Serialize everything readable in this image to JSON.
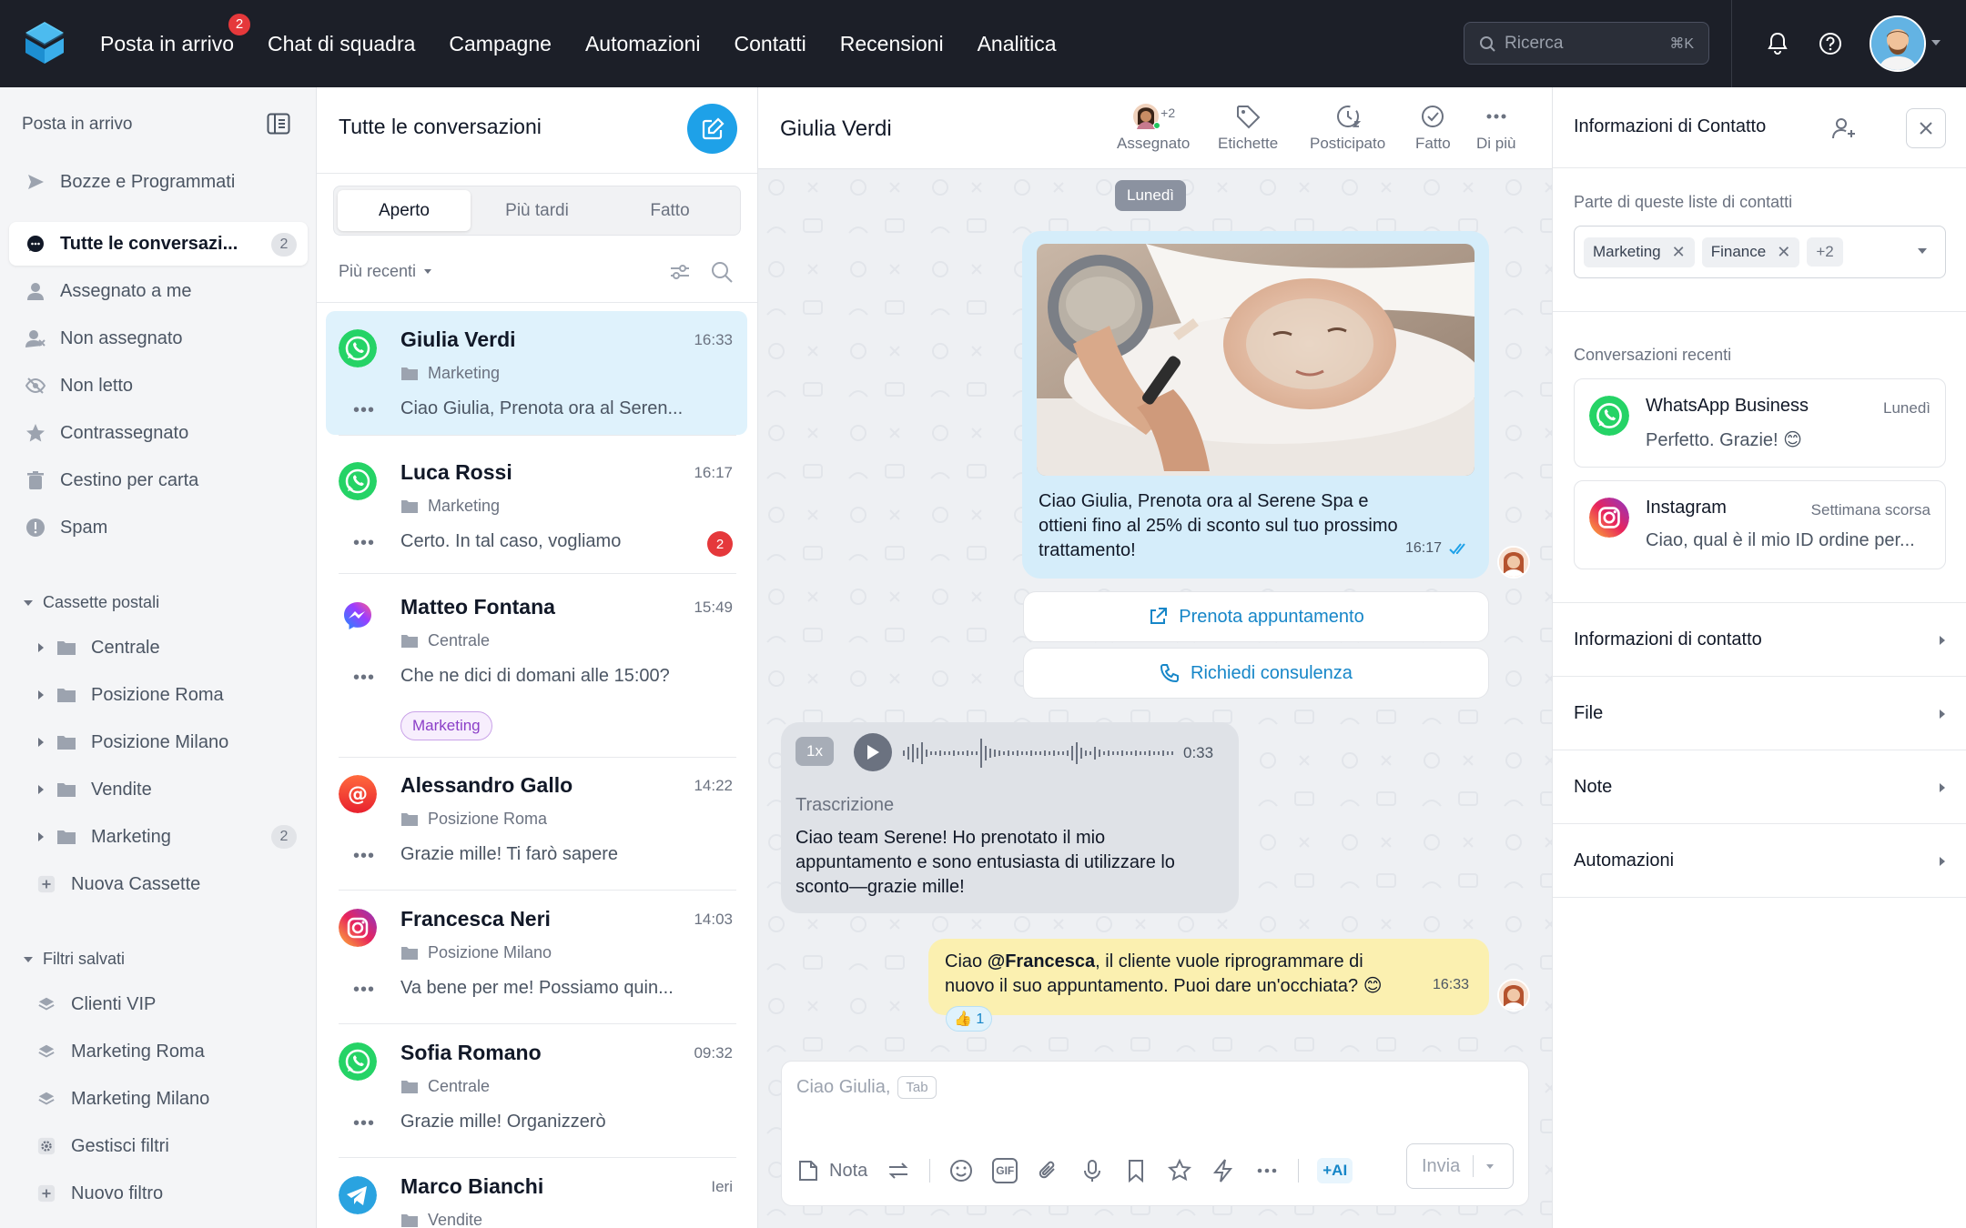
{
  "topnav": {
    "items": [
      "Posta in arrivo",
      "Chat di squadra",
      "Campagne",
      "Automazioni",
      "Contatti",
      "Recensioni",
      "Analitica"
    ],
    "inbox_badge": "2",
    "search_placeholder": "Ricerca",
    "search_shortcut": "⌘K",
    "icons": [
      "bell-icon",
      "help-icon"
    ]
  },
  "sidebar": {
    "title": "Posta in arrivo",
    "items": [
      {
        "label": "Bozze e Programmati",
        "icon": "send-icon"
      },
      {
        "label": "Tutte le conversazi...",
        "icon": "chat-icon",
        "count": "2",
        "active": true
      },
      {
        "label": "Assegnato a me",
        "icon": "user-icon"
      },
      {
        "label": "Non assegnato",
        "icon": "user-x-icon"
      },
      {
        "label": "Non letto",
        "icon": "eye-off-icon"
      },
      {
        "label": "Contrassegnato",
        "icon": "star-icon"
      },
      {
        "label": "Cestino per carta",
        "icon": "trash-icon"
      },
      {
        "label": "Spam",
        "icon": "alert-icon"
      }
    ],
    "mailboxes_title": "Cassette postali",
    "mailboxes": [
      {
        "label": "Centrale"
      },
      {
        "label": "Posizione Roma"
      },
      {
        "label": "Posizione Milano"
      },
      {
        "label": "Vendite"
      },
      {
        "label": "Marketing",
        "count": "2"
      }
    ],
    "new_mailbox": "Nuova Cassette",
    "filters_title": "Filtri salvati",
    "filters": [
      "Clienti VIP",
      "Marketing Roma",
      "Marketing Milano"
    ],
    "manage_filters": "Gestisci filtri",
    "new_filter": "Nuovo filtro"
  },
  "convlist": {
    "title": "Tutte le conversazioni",
    "tabs": [
      "Aperto",
      "Più tardi",
      "Fatto"
    ],
    "sort": "Più recenti",
    "conversations": [
      {
        "name": "Giulia Verdi",
        "time": "16:33",
        "folder": "Marketing",
        "preview": "Ciao Giulia, Prenota ora al Seren...",
        "channel": "whatsapp"
      },
      {
        "name": "Luca Rossi",
        "time": "16:17",
        "folder": "Marketing",
        "preview": "Certo. In tal caso, vogliamo",
        "channel": "whatsapp",
        "unread": "2"
      },
      {
        "name": "Matteo Fontana",
        "time": "15:49",
        "folder": "Centrale",
        "preview": "Che ne dici di domani alle 15:00?",
        "channel": "messenger",
        "tag": "Marketing"
      },
      {
        "name": "Alessandro Gallo",
        "time": "14:22",
        "folder": "Posizione Roma",
        "preview": "Grazie mille! Ti farò sapere",
        "channel": "email"
      },
      {
        "name": "Francesca Neri",
        "time": "14:03",
        "folder": "Posizione Milano",
        "preview": "Va bene per me! Possiamo quin...",
        "channel": "instagram"
      },
      {
        "name": "Sofia Romano",
        "time": "09:32",
        "folder": "Centrale",
        "preview": "Grazie mille! Organizzerò",
        "channel": "whatsapp"
      },
      {
        "name": "Marco Bianchi",
        "time": "Ieri",
        "folder": "Vendite",
        "preview": "",
        "channel": "telegram"
      }
    ]
  },
  "chat": {
    "title": "Giulia Verdi",
    "assignee_extra": "+2",
    "actions": [
      "Assegnato",
      "Etichette",
      "Posticipato",
      "Fatto",
      "Di più"
    ],
    "day": "Lunedì",
    "outgoing_text": "Ciao Giulia, Prenota ora al Serene Spa e ottieni fino al 25% di sconto sul tuo prossimo trattamento!",
    "outgoing_time": "16:17",
    "cta_1": "Prenota appuntamento",
    "cta_2": "Richiedi consulenza",
    "audio_speed": "1x",
    "audio_duration": "0:33",
    "transcript_label": "Trascrizione",
    "transcript_text": "Ciao team Serene! Ho prenotato il mio appuntamento e sono entusiasta di utilizzare lo sconto—grazie mille!",
    "note_prefix": "Ciao ",
    "note_mention": "@Francesca",
    "note_rest": ", il cliente vuole riprogrammare di nuovo il suo appuntamento. Puoi dare un'occhiata? 😊",
    "note_time": "16:33",
    "reaction": "👍 1",
    "composer_placeholder": "Ciao Giulia,",
    "composer_tab": "Tab",
    "nota_label": "Nota",
    "gif_label": "GIF",
    "ai_label": "+AI",
    "send_label": "Invia"
  },
  "contact": {
    "title": "Informazioni di Contatto",
    "lists_label": "Parte di queste liste di contatti",
    "lists": [
      "Marketing",
      "Finance"
    ],
    "lists_more": "+2",
    "recent_label": "Conversazioni recenti",
    "recent": [
      {
        "channel": "WhatsApp Business",
        "time": "Lunedì",
        "preview": "Perfetto. Grazie! 😊"
      },
      {
        "channel": "Instagram",
        "time": "Settimana scorsa",
        "preview": "Ciao, qual è il mio ID ordine per..."
      }
    ],
    "sections": [
      "Informazioni di contatto",
      "File",
      "Note",
      "Automazioni"
    ]
  }
}
